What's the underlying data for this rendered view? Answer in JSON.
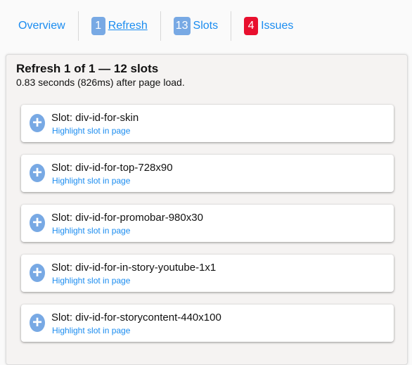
{
  "nav": {
    "overview": "Overview",
    "refresh": {
      "count": "1",
      "label": "Refresh",
      "color": "#78a9e4"
    },
    "slots": {
      "count": "13",
      "label": "Slots",
      "color": "#78a9e4"
    },
    "issues": {
      "count": "4",
      "label": "Issues",
      "color": "#e8102e"
    }
  },
  "panel": {
    "title": "Refresh 1 of 1 — 12 slots",
    "subtitle": "0.83 seconds (826ms) after page load.",
    "slots": [
      {
        "name": "Slot: div-id-for-skin",
        "link": "Highlight slot in page"
      },
      {
        "name": "Slot: div-id-for-top-728x90",
        "link": "Highlight slot in page"
      },
      {
        "name": "Slot: div-id-for-promobar-980x30",
        "link": "Highlight slot in page"
      },
      {
        "name": "Slot: div-id-for-in-story-youtube-1x1",
        "link": "Highlight slot in page"
      },
      {
        "name": "Slot: div-id-for-storycontent-440x100",
        "link": "Highlight slot in page"
      }
    ]
  }
}
